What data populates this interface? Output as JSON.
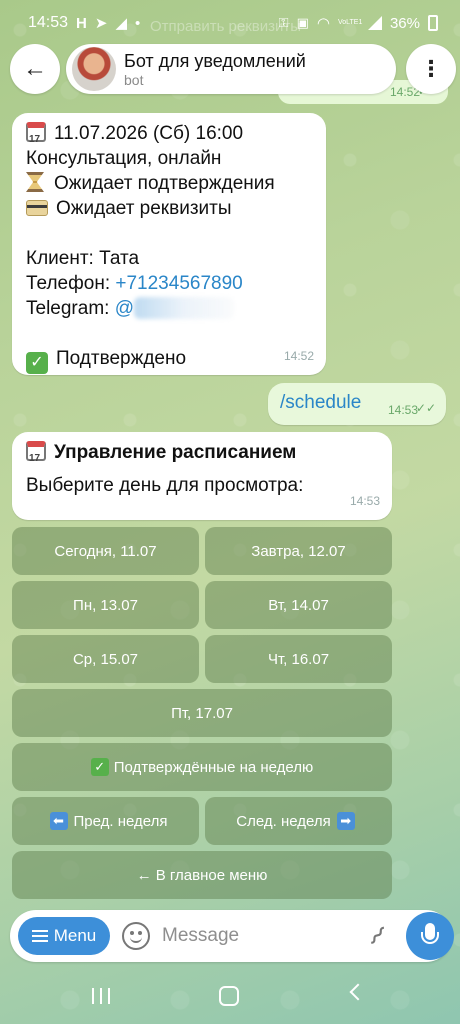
{
  "status_bar": {
    "time": "14:53",
    "left_icons": [
      "whatsapp-icon",
      "navigation-icon",
      "telegram-icon",
      "dot-icon"
    ],
    "ghost_text": "Отправить реквизиты",
    "right_icons": [
      "vpn-key-icon",
      "lock-icon",
      "wifi-icon",
      "lte-icon",
      "signal-icon"
    ],
    "network": "VoLTE1",
    "battery": "36%"
  },
  "header": {
    "bot_name": "Бот для уведомлений",
    "bot_subtitle": "bot"
  },
  "peek_message": {
    "time": "14:52",
    "ticks": "✓✓"
  },
  "message_booking": {
    "date_line": "11.07.2026 (Сб) 16:00",
    "service": "Консультация, онлайн",
    "status_confirm": "Ожидает подтверждения",
    "status_payment": "Ожидает реквизиты",
    "client": "Клиент: Тата",
    "phone_label": "Телефон: ",
    "phone": "+71234567890",
    "telegram_label": "Telegram: ",
    "telegram_handle": "@",
    "confirmed": "Подтверждено",
    "time": "14:52"
  },
  "message_out": {
    "command": "/schedule",
    "time": "14:53",
    "ticks": "✓✓"
  },
  "message_schedule": {
    "title": "Управление расписанием",
    "prompt": "Выберите день для просмотра:",
    "time": "14:53"
  },
  "keyboard": {
    "today": "Сегодня, 11.07",
    "tomorrow": "Завтра, 12.07",
    "mon": "Пн, 13.07",
    "tue": "Вт, 14.07",
    "wed": "Ср, 15.07",
    "thu": "Чт, 16.07",
    "fri": "Пт, 17.07",
    "confirmed_week": "Подтверждённые на неделю",
    "prev_week": "Пред. неделя",
    "next_week": "След. неделя",
    "main_menu": "← В главное меню"
  },
  "composer": {
    "menu_label": "Menu",
    "placeholder": "Message"
  },
  "colors": {
    "accent": "#3d8fd9",
    "link": "#2a86c8",
    "outgoing_bubble": "#e8f8db",
    "keyboard_button": "#5c7a4a"
  }
}
